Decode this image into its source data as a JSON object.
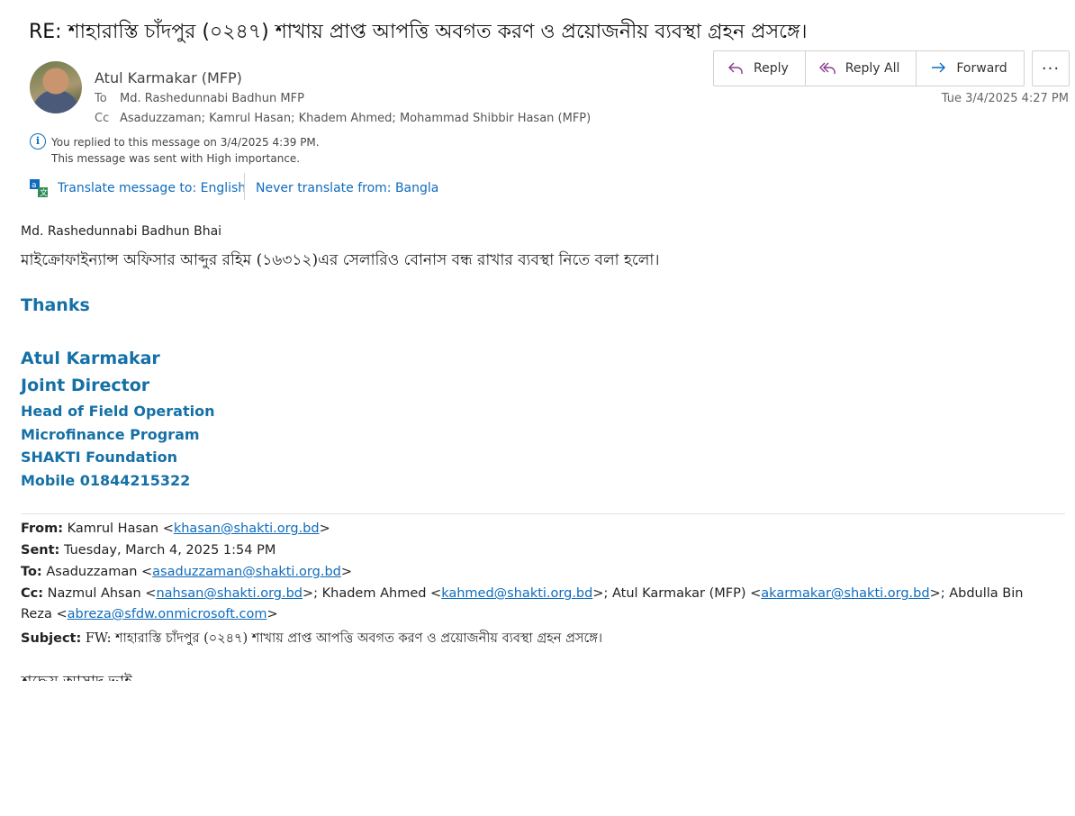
{
  "subject": "RE: শাহারাস্তি চাঁদপুর (০২৪৭) শাখায় প্রাপ্ত আপত্তি অবগত করণ ও প্রয়োজনীয় ব্যবস্থা গ্রহন প্রসঙ্গে।",
  "sender": "Atul  Karmakar (MFP)",
  "to_label": "To",
  "to": "Md. Rashedunnabi Badhun MFP",
  "cc_label": "Cc",
  "cc": "Asaduzzaman; Kamrul Hasan; Khadem Ahmed; Mohammad Shibbir Hasan (MFP)",
  "date": "Tue 3/4/2025 4:27 PM",
  "actions": {
    "reply": "Reply",
    "reply_all": "Reply All",
    "forward": "Forward",
    "more": "···"
  },
  "info": {
    "replied": "You replied to this message on 3/4/2025 4:39 PM.",
    "importance": "This message was sent with High importance."
  },
  "translate": {
    "to": "Translate message to: English",
    "never": "Never translate from: Bangla"
  },
  "body": {
    "greeting": "Md. Rashedunnabi Badhun Bhai",
    "line": "মাইক্রোফাইন্যান্স অফিসার আব্দুর রহিম (১৬৩১২)এর সেলারিও বোনাস বন্ধ রাখার ব্যবস্থা নিতে বলা হলো।",
    "thanks": "Thanks"
  },
  "signature": {
    "name": "Atul Karmakar",
    "title": "Joint Director",
    "role": "Head of Field Operation",
    "program": "Microfinance Program",
    "org": "SHAKTI Foundation",
    "mobile": "Mobile 01844215322"
  },
  "forwarded": {
    "from_label": "From:",
    "from_name": "Kamrul Hasan <",
    "from_email": "khasan@shakti.org.bd",
    "from_end": ">",
    "sent_label": "Sent:",
    "sent": "Tuesday, March 4, 2025 1:54 PM",
    "to_label": "To:",
    "to_name": "Asaduzzaman <",
    "to_email": "asaduzzaman@shakti.org.bd",
    "to_end": ">",
    "cc_label": "Cc:",
    "cc1_name": "Nazmul Ahsan <",
    "cc1_email": "nahsan@shakti.org.bd",
    "cc2_name": ">; Khadem Ahmed <",
    "cc2_email": "kahmed@shakti.org.bd",
    "cc3_name": ">; Atul Karmakar (MFP) <",
    "cc3_email": "akarmakar@shakti.org.bd",
    "cc4_name": ">; Abdulla Bin",
    "cc4_cont": "Reza <",
    "cc4_email": "abreza@sfdw.onmicrosoft.com",
    "cc4_end": ">",
    "subject_label": "Subject:",
    "subject": "FW: শাহারাস্তি চাঁদপুর (০২৪৭) শাখায় প্রাপ্ত আপত্তি অবগত করণ ও প্রয়োজনীয় ব্যবস্থা গ্রহন প্রসঙ্গে।",
    "truncated_line": "শ্রদ্ধেয় আসাদ ভাই"
  },
  "colors": {
    "link": "#0f6cbd",
    "signature": "#1570a6"
  }
}
